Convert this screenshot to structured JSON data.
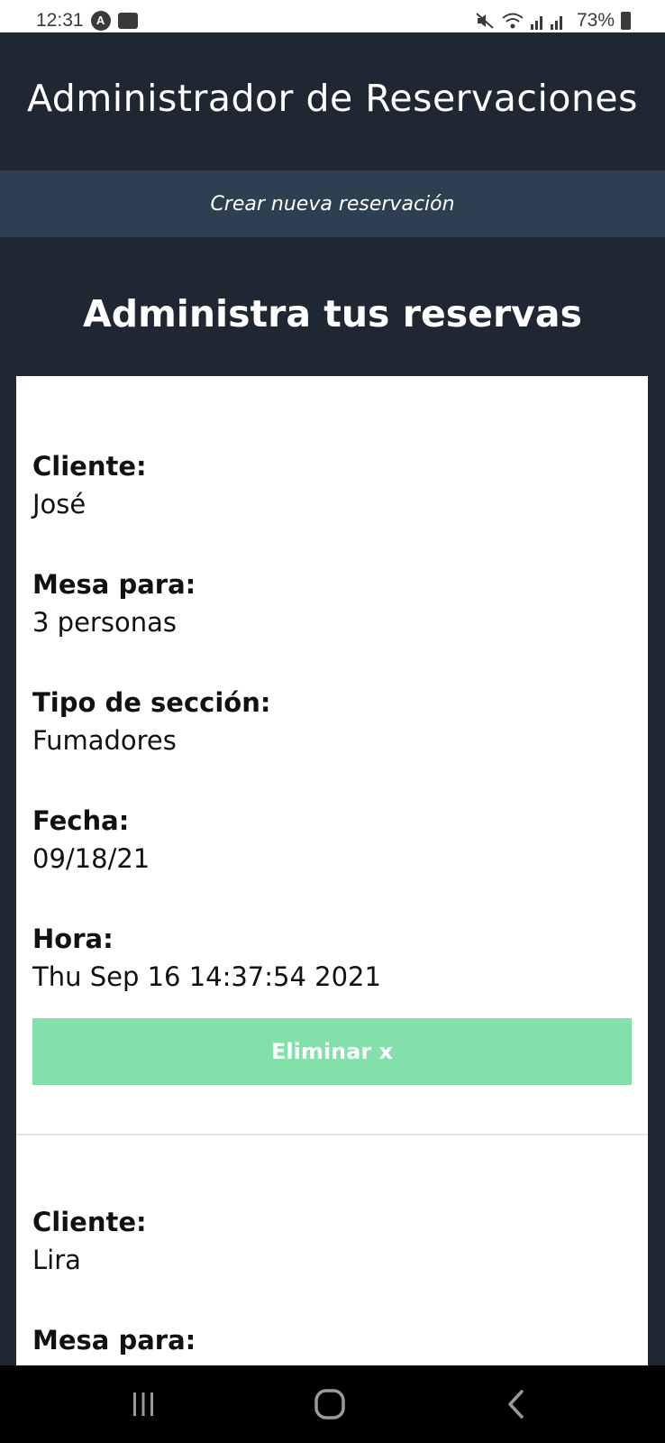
{
  "status_bar": {
    "time": "12:31",
    "badge_glyph": "A",
    "battery": "73%"
  },
  "header": {
    "title": "Administrador de Reservaciones"
  },
  "nav": {
    "create_link": "Crear nueva reservación"
  },
  "main": {
    "heading": "Administra tus reservas",
    "reservations": [
      {
        "client_label": "Cliente:",
        "client": "José",
        "table_label": "Mesa para:",
        "table": "3 personas",
        "section_label": "Tipo de sección:",
        "section": "Fumadores",
        "date_label": "Fecha:",
        "date": "09/18/21",
        "time_label": "Hora:",
        "time": "Thu Sep 16 14:37:54 2021",
        "delete_label": "Eliminar x"
      },
      {
        "client_label": "Cliente:",
        "client": "Lira",
        "table_label": "Mesa para:"
      }
    ]
  },
  "colors": {
    "header_bg": "#1f2733",
    "nav_bg": "#2e3f52",
    "delete_button_bg": "#83e0ab",
    "card_bg": "#ffffff"
  },
  "system_nav": {
    "icons": [
      "recent-apps-icon",
      "home-icon",
      "back-icon"
    ]
  }
}
